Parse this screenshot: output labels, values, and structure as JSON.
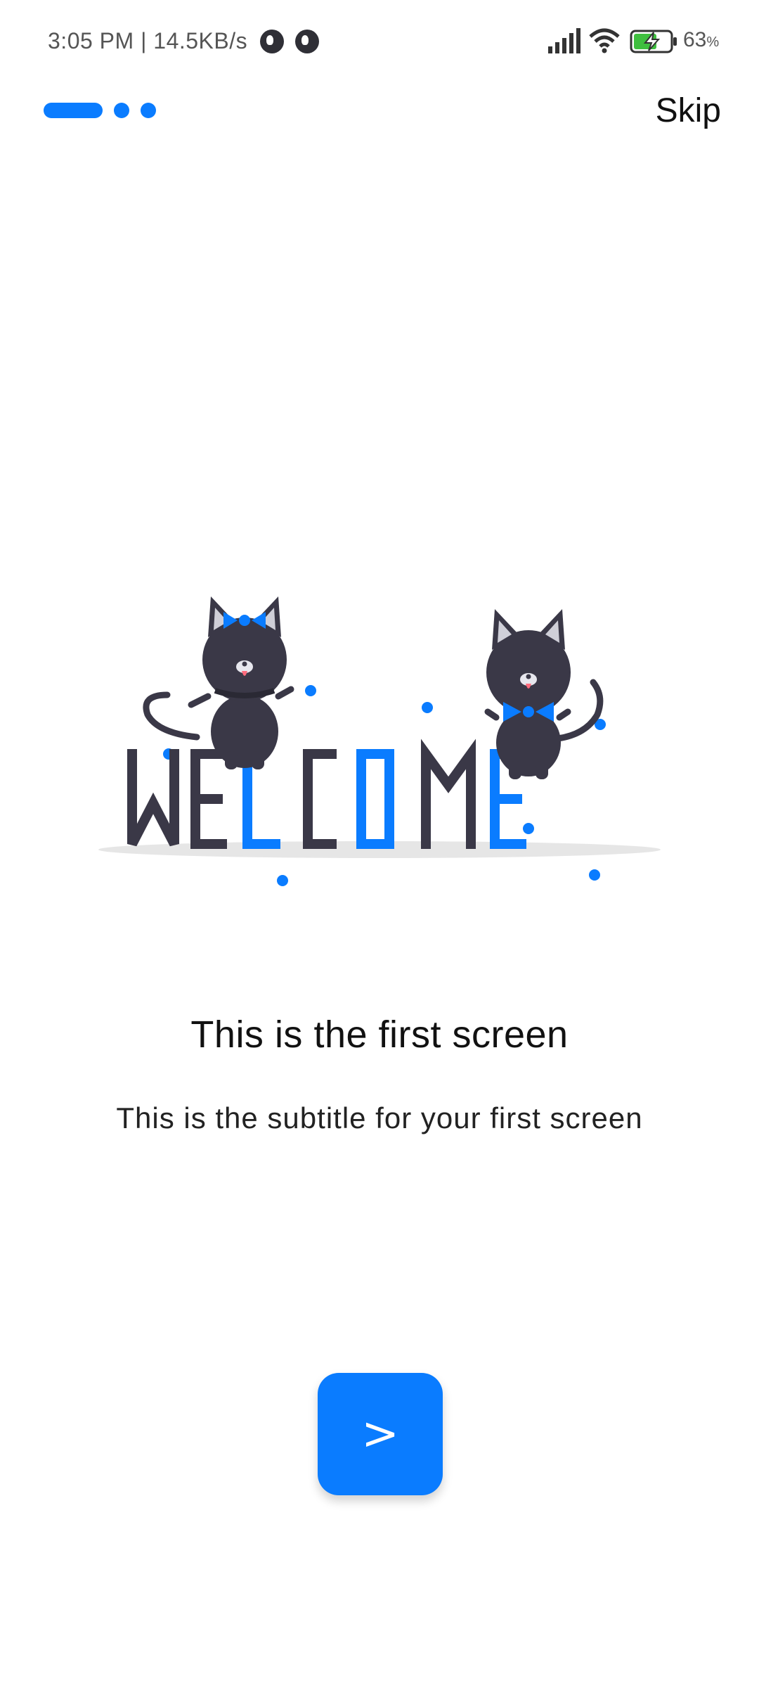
{
  "status_bar": {
    "time": "3:05 PM | 14.5KB/s",
    "battery_percent": "63",
    "battery_suffix": "%"
  },
  "onboarding": {
    "skip_label": "Skip",
    "page_index": 1,
    "page_count": 3,
    "illustration_text": "WELCOME",
    "title": "This is the first screen",
    "subtitle": "This is the subtitle for your first screen",
    "next_label": ">"
  },
  "colors": {
    "accent": "#0a7cff",
    "dark": "#3a3847"
  }
}
